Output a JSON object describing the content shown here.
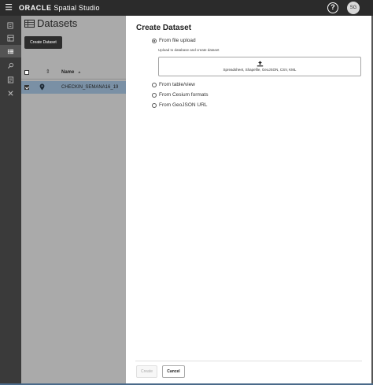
{
  "app": {
    "brand_oracle": "ORACLE",
    "brand_product": "Spatial Studio",
    "help_glyph": "?",
    "user_initials": "SG"
  },
  "sidebar": {
    "items": [
      {
        "icon": "projects-icon",
        "active": false
      },
      {
        "icon": "pages-icon",
        "active": false
      },
      {
        "icon": "datasets-icon",
        "active": true
      },
      {
        "icon": "search-icon",
        "active": false
      },
      {
        "icon": "jobs-icon",
        "active": false
      },
      {
        "icon": "tools-icon",
        "active": false
      }
    ]
  },
  "datasets_page": {
    "title": "Datasets",
    "create_button": "Create Dataset",
    "table": {
      "columns": {
        "name": "Name"
      },
      "sort_glyph": "▲",
      "rows": [
        {
          "name": "CHECKIN_SEMANA16_19",
          "checked": true,
          "type_icon": "map-pin-icon"
        }
      ]
    }
  },
  "dialog": {
    "title": "Create Dataset",
    "options": [
      {
        "label": "From file upload",
        "selected": true
      },
      {
        "label": "From table/view",
        "selected": false
      },
      {
        "label": "From Cesium formats",
        "selected": false
      },
      {
        "label": "From GeoJSON URL",
        "selected": false
      }
    ],
    "upload_hint": "Upload to database and create dataset",
    "dropzone_text": "Spreadsheet, Shapefile, GeoJSON, CSV, KML",
    "buttons": {
      "create": "Create",
      "cancel": "Cancel"
    }
  },
  "colors": {
    "topbar": "#2b2b2b",
    "sidebar": "#3a3a3a",
    "overlay_dimmed_page": "#aaaaaa",
    "selected_row": "#7a90a5",
    "dialog_bg": "#ffffff"
  }
}
